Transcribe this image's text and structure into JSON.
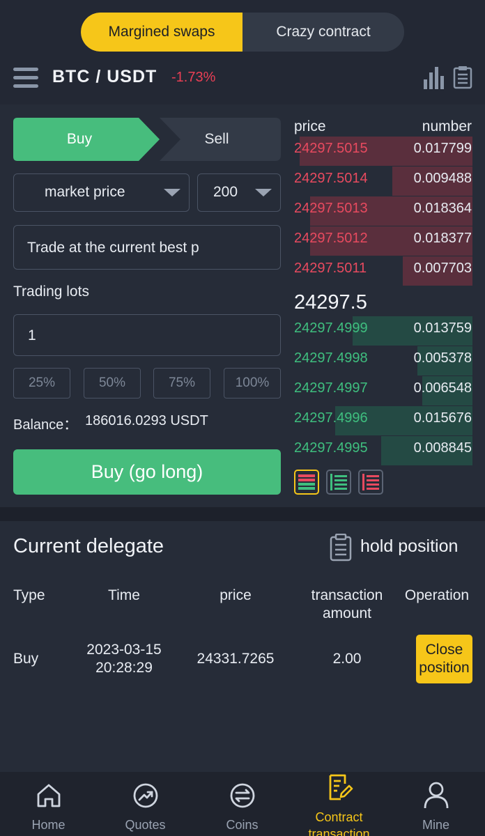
{
  "tabs": {
    "margined": "Margined swaps",
    "crazy": "Crazy contract"
  },
  "header": {
    "pair": "BTC / USDT",
    "change": "-1.73%"
  },
  "trade": {
    "buy_tab": "Buy",
    "sell_tab": "Sell",
    "order_type": "market price",
    "leverage": "200",
    "price_placeholder": "Trade at the current best p",
    "lots_label": "Trading lots",
    "lots_value": "1",
    "pcts": [
      "25%",
      "50%",
      "75%",
      "100%"
    ],
    "balance_label": "Balance：",
    "balance_value": "186016.0293 USDT",
    "buy_button": "Buy (go long)"
  },
  "orderbook": {
    "price_header": "price",
    "number_header": "number",
    "asks": [
      {
        "price": "24297.5015",
        "number": "0.017799",
        "depth": 0.97
      },
      {
        "price": "24297.5014",
        "number": "0.009488",
        "depth": 0.45
      },
      {
        "price": "24297.5013",
        "number": "0.018364",
        "depth": 0.91
      },
      {
        "price": "24297.5012",
        "number": "0.018377",
        "depth": 0.91
      },
      {
        "price": "24297.5011",
        "number": "0.007703",
        "depth": 0.39
      }
    ],
    "last_price": "24297.5",
    "bids": [
      {
        "price": "24297.4999",
        "number": "0.013759",
        "depth": 0.67
      },
      {
        "price": "24297.4998",
        "number": "0.005378",
        "depth": 0.31
      },
      {
        "price": "24297.4997",
        "number": "0.006548",
        "depth": 0.28
      },
      {
        "price": "24297.4996",
        "number": "0.015676",
        "depth": 0.77
      },
      {
        "price": "24297.4995",
        "number": "0.008845",
        "depth": 0.51
      }
    ]
  },
  "delegate": {
    "title": "Current delegate",
    "hold": "hold position",
    "headers": {
      "type": "Type",
      "time": "Time",
      "price": "price",
      "amount_l1": "transaction",
      "amount_l2": "amount",
      "operation": "Operation"
    },
    "row": {
      "type": "Buy",
      "date": "2023-03-15",
      "time": "20:28:29",
      "price": "24331.7265",
      "amount": "2.00",
      "close_l1": "Close",
      "close_l2": "position"
    }
  },
  "nav": {
    "home": "Home",
    "quotes": "Quotes",
    "coins": "Coins",
    "contract_l1": "Contract",
    "contract_l2": "transaction",
    "mine": "Mine"
  },
  "colors": {
    "accent": "#f6c619",
    "buy": "#47bd7d",
    "sell": "#e84a5f"
  }
}
